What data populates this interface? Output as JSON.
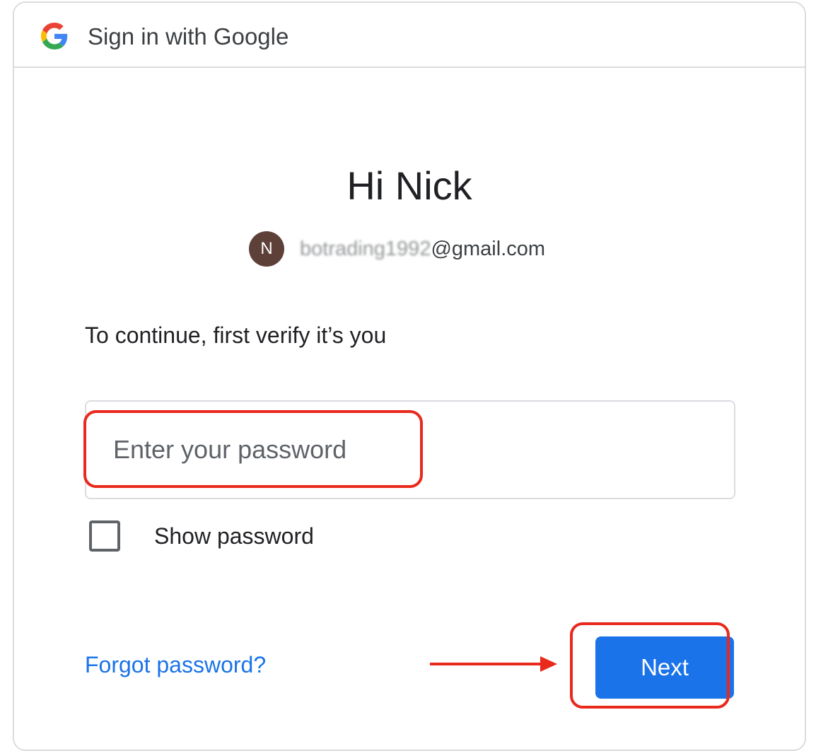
{
  "header": {
    "title": "Sign in with Google",
    "logo_icon": "google-g-icon"
  },
  "account": {
    "greeting": "Hi Nick",
    "avatar_initial": "N",
    "email_obscured": "botrading1992",
    "email_visible": "@gmail.com"
  },
  "verify": {
    "subtitle": "To continue, first verify it’s you",
    "password_placeholder": "Enter your password",
    "password_value": "",
    "show_password_label": "Show password",
    "show_password_checked": false
  },
  "actions": {
    "forgot_label": "Forgot password?",
    "next_label": "Next"
  },
  "colors": {
    "accent": "#1a73e8",
    "annotation": "#e8291c",
    "avatar": "#5d4037",
    "border": "#dadce0"
  }
}
